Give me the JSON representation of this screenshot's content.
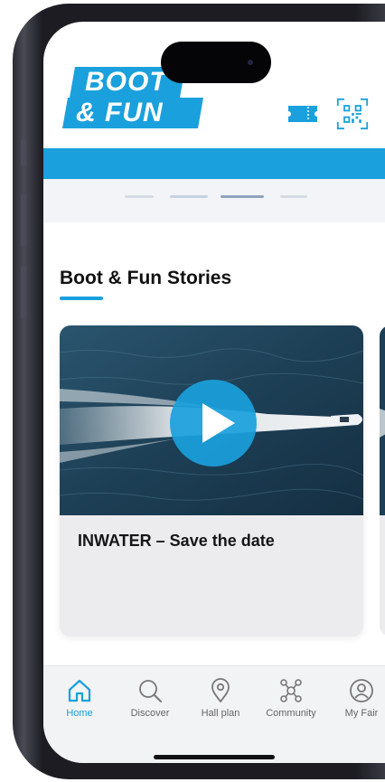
{
  "header": {
    "logo_line1": "BOOT",
    "logo_line2": "& FUN",
    "ticket_icon": "ticket-icon",
    "qr_icon": "qr-code-icon"
  },
  "carousel": {
    "active_index": 2,
    "count": 4
  },
  "stories": {
    "title": "Boot & Fun Stories",
    "cards": [
      {
        "title": "INWATER – Save the date",
        "media": "video",
        "icon": "play-icon"
      }
    ]
  },
  "nav": {
    "items": [
      {
        "label": "Home",
        "icon": "home-icon",
        "active": true
      },
      {
        "label": "Discover",
        "icon": "search-icon",
        "active": false
      },
      {
        "label": "Hall plan",
        "icon": "map-pin-icon",
        "active": false
      },
      {
        "label": "Community",
        "icon": "network-icon",
        "active": false
      },
      {
        "label": "My Fair",
        "icon": "user-icon",
        "active": false
      }
    ]
  },
  "colors": {
    "accent": "#1aa0dc",
    "inactive": "#666666",
    "water": "#1d3f55"
  }
}
